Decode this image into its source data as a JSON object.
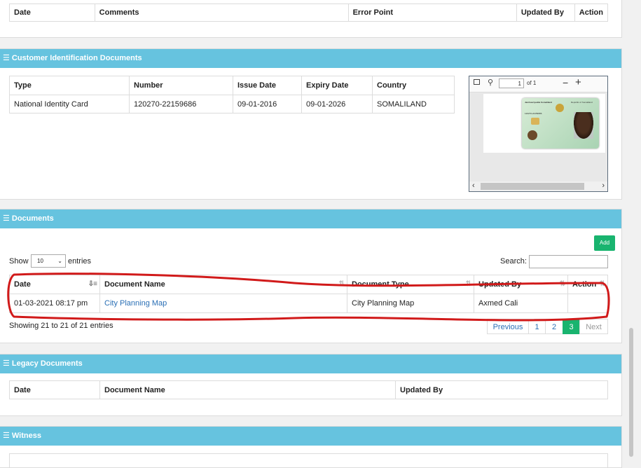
{
  "top_table": {
    "headers": [
      "Date",
      "Comments",
      "Error Point",
      "Updated By",
      "Action"
    ]
  },
  "customer_docs": {
    "title": "Customer Identification Documents",
    "headers": [
      "Type",
      "Number",
      "Issue Date",
      "Expiry Date",
      "Country"
    ],
    "row": [
      "National Identity Card",
      "120270-22159686",
      "09-01-2016",
      "09-01-2026",
      "SOMALILAND"
    ],
    "viewer": {
      "page": "1",
      "of_label": "of 1",
      "minus": "−",
      "plus": "+"
    },
    "card": {
      "republic_label": "Republic of Somaliland",
      "issuer_label": "Jamhuuriyadda Somaliland",
      "number_text": "120270-22159686"
    }
  },
  "documents": {
    "title": "Documents",
    "add_label": "Add",
    "show_label": "Show",
    "entries_label": "entries",
    "length_value": "10",
    "search_label": "Search:",
    "headers": [
      "Date",
      "Document Name",
      "Document Type",
      "Updated By",
      "Action"
    ],
    "row": {
      "date": "01-03-2021 08:17 pm",
      "name": "City Planning Map",
      "type": "City Planning Map",
      "updated_by": "Axmed Cali",
      "action": ""
    },
    "info": "Showing 21 to 21 of 21 entries",
    "pager": [
      "Previous",
      "1",
      "2",
      "3",
      "Next"
    ]
  },
  "legacy": {
    "title": "Legacy Documents",
    "headers": [
      "Date",
      "Document Name",
      "Updated By"
    ]
  },
  "witness": {
    "title": "Witness"
  },
  "colors": {
    "header": "#66c3df",
    "add": "#19b46f",
    "annotation": "#d11a1a",
    "link": "#2a6fb5"
  }
}
